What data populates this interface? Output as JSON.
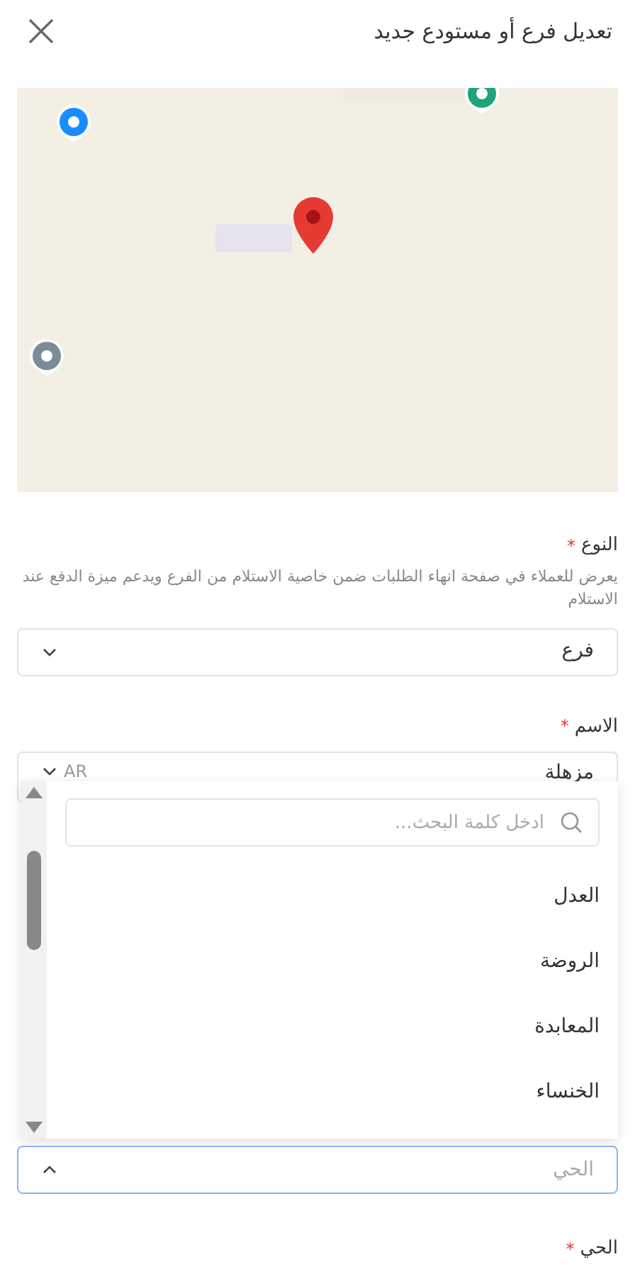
{
  "header": {
    "title": "تعديل فرع أو مستودع جديد"
  },
  "type_field": {
    "label": "النوع",
    "required_mark": "*",
    "hint": "يعرض للعملاء في صفحة انهاء الطلبات ضمن خاصية الاستلام من الفرع ويدعم ميزة الدفع عند الاستلام",
    "value": "فرع",
    "expanded": false
  },
  "name_field": {
    "label": "الاسم",
    "required_mark": "*",
    "value": "مزهلة",
    "language": "AR"
  },
  "dropdown": {
    "search_placeholder": "ادخل كلمة البحث...",
    "options": [
      {
        "label": "العدل",
        "selected": false
      },
      {
        "label": "الروضة",
        "selected": false
      },
      {
        "label": "المعابدة",
        "selected": false
      },
      {
        "label": "الخنساء",
        "selected": false
      }
    ]
  },
  "district_select": {
    "placeholder": "الحي",
    "expanded": true
  },
  "district_label": {
    "label": "الحي",
    "required_mark": "*"
  }
}
